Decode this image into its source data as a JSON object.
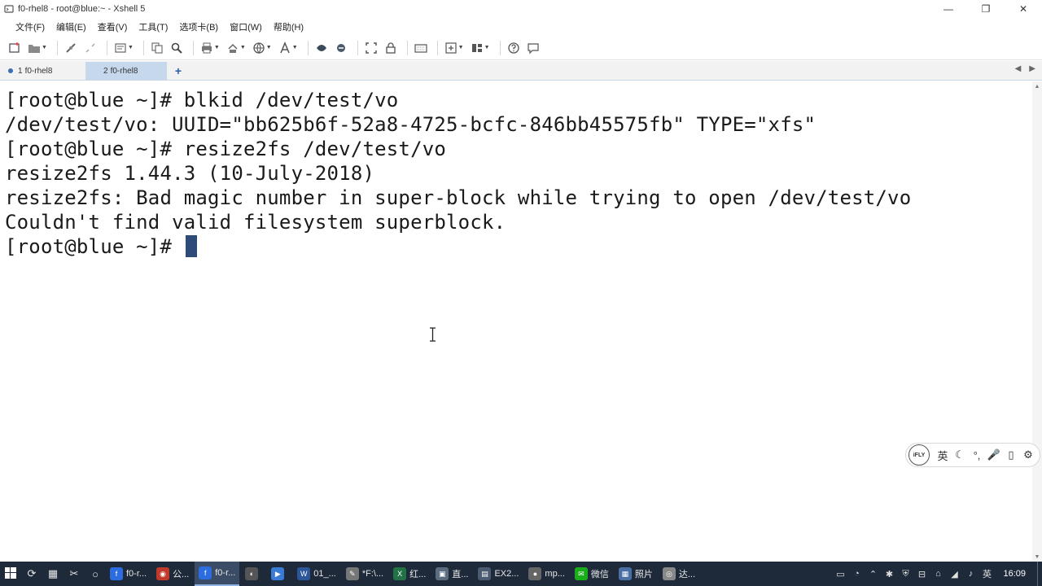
{
  "window": {
    "title": "f0-rhel8 - root@blue:~ - Xshell 5",
    "controls": {
      "minimize": "—",
      "restore": "❐",
      "close": "✕"
    }
  },
  "menu": [
    "文件(F)",
    "编辑(E)",
    "查看(V)",
    "工具(T)",
    "选项卡(B)",
    "窗口(W)",
    "帮助(H)"
  ],
  "tabs": [
    {
      "num": "1",
      "label": "f0-rhel8",
      "active": false
    },
    {
      "num": "2",
      "label": "f0-rhel8",
      "active": true
    }
  ],
  "tab_add": "+",
  "tab_nav": {
    "prev": "◀",
    "next": "▶"
  },
  "terminal": {
    "lines": [
      "[root@blue ~]# blkid /dev/test/vo",
      "/dev/test/vo: UUID=\"bb625b6f-52a8-4725-bcfc-846bb45575fb\" TYPE=\"xfs\"",
      "[root@blue ~]# resize2fs /dev/test/vo",
      "resize2fs 1.44.3 (10-July-2018)",
      "resize2fs: Bad magic number in super-block while trying to open /dev/test/vo",
      "Couldn't find valid filesystem superblock.",
      "[root@blue ~]# "
    ]
  },
  "ime": {
    "logo": "iFLY",
    "items": [
      "英",
      "☾",
      "°,",
      "🎤",
      "▯",
      "⚙"
    ]
  },
  "taskbar": {
    "apps": [
      {
        "label": "f0-r...",
        "color": "#2d6cdf",
        "glyph": "f"
      },
      {
        "label": "公...",
        "color": "#c0392b",
        "glyph": "◉"
      },
      {
        "label": "f0-r...",
        "color": "#2d6cdf",
        "glyph": "f",
        "active": true
      },
      {
        "label": "",
        "color": "#555555",
        "glyph": "◐"
      },
      {
        "label": "",
        "color": "#3a7bd5",
        "glyph": "▶"
      },
      {
        "label": "01_...",
        "color": "#2b579a",
        "glyph": "W"
      },
      {
        "label": "*F:\\...",
        "color": "#777777",
        "glyph": "✎"
      },
      {
        "label": "红...",
        "color": "#217346",
        "glyph": "X"
      },
      {
        "label": "直...",
        "color": "#5b6b80",
        "glyph": "▣"
      },
      {
        "label": "EX2...",
        "color": "#4a5a70",
        "glyph": "▤"
      },
      {
        "label": "mp...",
        "color": "#666666",
        "glyph": "●"
      },
      {
        "label": "微信",
        "color": "#1aad19",
        "glyph": "✉"
      },
      {
        "label": "照片",
        "color": "#4a6fa5",
        "glyph": "▦"
      },
      {
        "label": "达...",
        "color": "#888888",
        "glyph": "◎"
      }
    ],
    "tray_icons": [
      "▭",
      "◔",
      "⌃",
      "✱",
      "⛨",
      "⊟",
      "⌂",
      "◢",
      "♪",
      "英"
    ],
    "clock": "16:09"
  }
}
